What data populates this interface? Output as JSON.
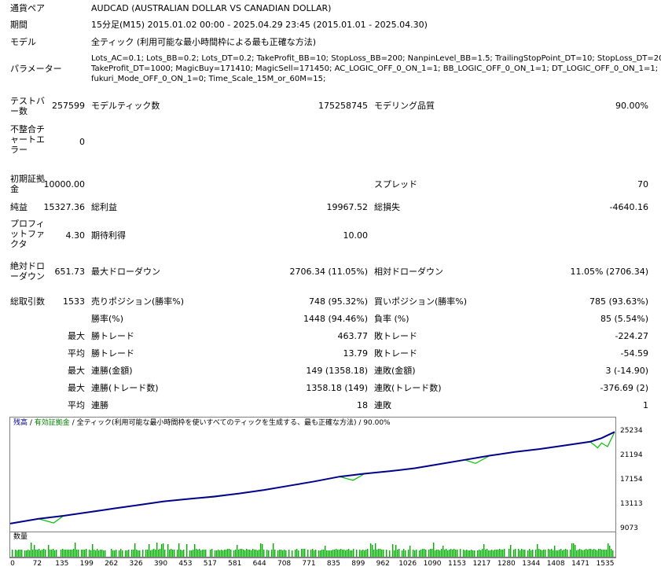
{
  "header": {
    "symbol_label": "通貨ペア",
    "symbol_value": "AUDCAD (AUSTRALIAN DOLLAR VS CANADIAN DOLLAR)",
    "period_label": "期間",
    "period_value": "15分足(M15) 2015.01.02 00:00 - 2025.04.29 23:45 (2015.01.01 - 2025.04.30)",
    "model_label": "モデル",
    "model_value": "全ティック (利用可能な最小時間枠による最も正確な方法)",
    "params_label": "パラメーター",
    "params_line1": "Lots_AC=0.1; Lots_BB=0.2; Lots_DT=0.2; TakeProfit_BB=10; StopLoss_BB=200; NanpinLevel_BB=1.5; TrailingStopPoint_DT=10; StopLoss_DT=200;",
    "params_line2": "TakeProfit_DT=1000; MagicBuy=171410; MagicSell=171450; AC_LOGIC_OFF_0_ON_1=1; BB_LOGIC_OFF_0_ON_1=1; DT_LOGIC_OFF_0_ON_1=1;",
    "params_line3": "fukuri_Mode_OFF_0_ON_1=0; Time_Scale_15M_or_60M=15;"
  },
  "stats": {
    "bars_label": "テストバー数",
    "bars_value": "257599",
    "ticks_label": "モデルティック数",
    "ticks_value": "175258745",
    "quality_label": "モデリング品質",
    "quality_value": "90.00%",
    "mismatch_label": "不整合チャートエラー",
    "mismatch_value": "0",
    "deposit_label": "初期証拠金",
    "deposit_value": "10000.00",
    "spread_label": "スプレッド",
    "spread_value": "70",
    "net_label": "純益",
    "net_value": "15327.36",
    "gross_profit_label": "総利益",
    "gross_profit_value": "19967.52",
    "gross_loss_label": "総損失",
    "gross_loss_value": "-4640.16",
    "pf_label": "プロフィットファクタ",
    "pf_value": "4.30",
    "expected_label": "期待利得",
    "expected_value": "10.00",
    "abs_dd_label": "絶対ドローダウン",
    "abs_dd_value": "651.73",
    "max_dd_label": "最大ドローダウン",
    "max_dd_value": "2706.34 (11.05%)",
    "rel_dd_label": "相対ドローダウン",
    "rel_dd_value": "11.05% (2706.34)",
    "trades_label": "総取引数",
    "trades_value": "1533",
    "short_label": "売りポジション(勝率%)",
    "short_value": "748 (95.32%)",
    "long_label": "買いポジション(勝率%)",
    "long_value": "785 (93.63%)",
    "win_label": "勝率(%)",
    "win_value": "1448 (94.46%)",
    "loss_label": "負率 (%)",
    "loss_value": "85 (5.54%)",
    "max_word": "最大",
    "avg_word": "平均",
    "max_win_label": "勝トレード",
    "max_win_value": "463.77",
    "max_loss_label": "敗トレード",
    "max_loss_value": "-224.27",
    "avg_win_label": "勝トレード",
    "avg_win_value": "13.79",
    "avg_loss_label": "敗トレード",
    "avg_loss_value": "-54.59",
    "cons_win_money_label": "連勝(金額)",
    "cons_win_money_value": "149 (1358.18)",
    "cons_loss_money_label": "連敗(金額)",
    "cons_loss_money_value": "3 (-14.90)",
    "cons_win_count_label": "連勝(トレード数)",
    "cons_win_count_value": "1358.18 (149)",
    "cons_loss_count_label": "連敗(トレード数)",
    "cons_loss_count_value": "-376.69 (2)",
    "avg_cons_win_label": "連勝",
    "avg_cons_win_value": "18",
    "avg_cons_loss_label": "連敗",
    "avg_cons_loss_value": "1"
  },
  "chart_legend": {
    "balance": "残高",
    "sep1": " / ",
    "equity": "有効証拠金",
    "sep2": " / ",
    "tick_text": "全ティック(利用可能な最小時間枠を使いすべてのティックを生成する、最も正確な方法)",
    "quality": " / 90.00%",
    "volume_label": "数量"
  },
  "colors": {
    "balance": "#00008b",
    "equity": "#00c000",
    "volume": "#00b000",
    "frame": "#808080"
  },
  "chart_data": {
    "type": "line",
    "x_ticks": [
      0,
      72,
      135,
      199,
      262,
      326,
      390,
      453,
      517,
      581,
      644,
      708,
      771,
      835,
      899,
      962,
      1026,
      1090,
      1153,
      1217,
      1280,
      1344,
      1408,
      1471,
      1535
    ],
    "y_ticks": [
      9073,
      13113,
      17154,
      21194,
      25234
    ],
    "xlim": [
      0,
      1533
    ],
    "ylim": [
      9073,
      25800
    ],
    "series": [
      {
        "name": "残高",
        "x": [
          0,
          72,
          135,
          199,
          262,
          326,
          390,
          453,
          517,
          581,
          644,
          708,
          771,
          835,
          899,
          962,
          1026,
          1090,
          1153,
          1217,
          1280,
          1344,
          1408,
          1471,
          1500,
          1533
        ],
        "values": [
          10000,
          10800,
          11300,
          11900,
          12500,
          13100,
          13700,
          14100,
          14500,
          15000,
          15600,
          16300,
          17000,
          17800,
          18300,
          18700,
          19200,
          19900,
          20600,
          21300,
          21900,
          22400,
          23000,
          23600,
          24200,
          25234
        ]
      },
      {
        "name": "有効証拠金",
        "x": [
          0,
          72,
          110,
          135,
          199,
          262,
          326,
          390,
          453,
          517,
          581,
          644,
          708,
          771,
          835,
          870,
          899,
          962,
          1026,
          1090,
          1153,
          1180,
          1217,
          1280,
          1344,
          1408,
          1471,
          1490,
          1500,
          1515,
          1533
        ],
        "values": [
          10000,
          10800,
          10100,
          11300,
          11900,
          12500,
          13100,
          13700,
          14100,
          14400,
          15000,
          15600,
          16300,
          17000,
          17800,
          17200,
          18300,
          18700,
          19200,
          19900,
          20600,
          20000,
          21300,
          21900,
          22400,
          23000,
          23600,
          22600,
          23400,
          22800,
          25234
        ]
      }
    ],
    "volume": {
      "x_range": [
        0,
        1533
      ],
      "note_levels": [
        0,
        1
      ]
    }
  }
}
